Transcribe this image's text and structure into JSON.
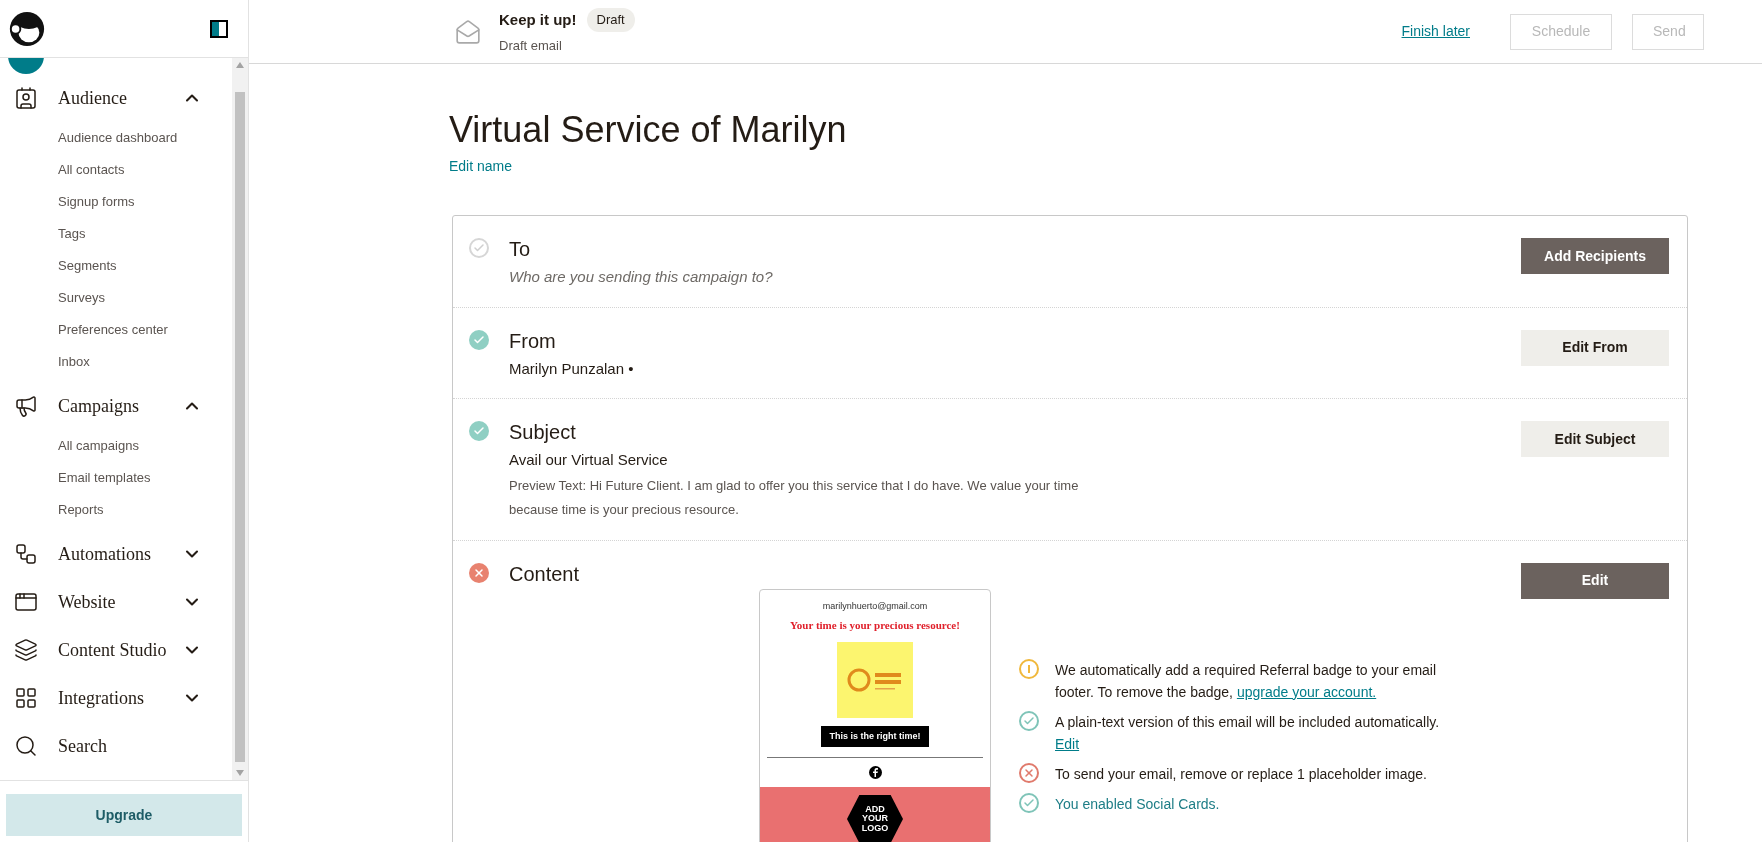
{
  "sidebar": {
    "sections": [
      {
        "label": "Audience",
        "expanded": true,
        "children": [
          "Audience dashboard",
          "All contacts",
          "Signup forms",
          "Tags",
          "Segments",
          "Surveys",
          "Preferences center",
          "Inbox"
        ]
      },
      {
        "label": "Campaigns",
        "expanded": true,
        "children": [
          "All campaigns",
          "Email templates",
          "Reports"
        ]
      },
      {
        "label": "Automations",
        "expanded": false
      },
      {
        "label": "Website",
        "expanded": false
      },
      {
        "label": "Content Studio",
        "expanded": false
      },
      {
        "label": "Integrations",
        "expanded": false
      },
      {
        "label": "Search"
      }
    ],
    "upgrade": "Upgrade"
  },
  "header": {
    "title": "Keep it up!",
    "badge": "Draft",
    "subtitle": "Draft email",
    "finish_later": "Finish later",
    "buttons": [
      {
        "label": "Schedule",
        "disabled": true
      },
      {
        "label": "Send",
        "disabled": true
      }
    ]
  },
  "campaign": {
    "name": "Virtual Service of Marilyn",
    "edit_name": "Edit name",
    "steps": [
      {
        "title": "To",
        "kind": "pending",
        "hint": "Who are you sending this campaign to?",
        "button": {
          "label": "Add Recipients",
          "primary": true
        }
      },
      {
        "title": "From",
        "kind": "complete",
        "line": "Marilyn Punzalan •",
        "button": {
          "label": "Edit From",
          "primary": false
        }
      },
      {
        "title": "Subject",
        "kind": "complete",
        "line": "Avail our Virtual Service",
        "detail": "Preview Text: Hi Future Client. I am glad to offer you this service that I do have. We value your time because time is your precious resource.",
        "button": {
          "label": "Edit Subject",
          "primary": false
        }
      },
      {
        "title": "Content",
        "kind": "error",
        "button": {
          "label": "Edit",
          "primary": true
        },
        "preview": {
          "sender": "marilynhuerto@gmail.com",
          "headline": "Your time is your precious resource!",
          "cta": "This is the right time!",
          "logo": "ADD YOUR LOGO"
        },
        "notes": [
          {
            "kind": "warning",
            "accent": false,
            "text": "We automatically add a required Referral badge to your email footer. To remove the badge,",
            "link": "upgrade your account."
          },
          {
            "kind": "success",
            "accent": false,
            "text": "A plain-text version of this email will be included automatically.",
            "link": "Edit"
          },
          {
            "kind": "error",
            "accent": false,
            "text": "To send your email, remove or replace 1 placeholder image."
          },
          {
            "kind": "success",
            "accent": true,
            "text": "You enabled Social Cards."
          }
        ]
      }
    ]
  }
}
